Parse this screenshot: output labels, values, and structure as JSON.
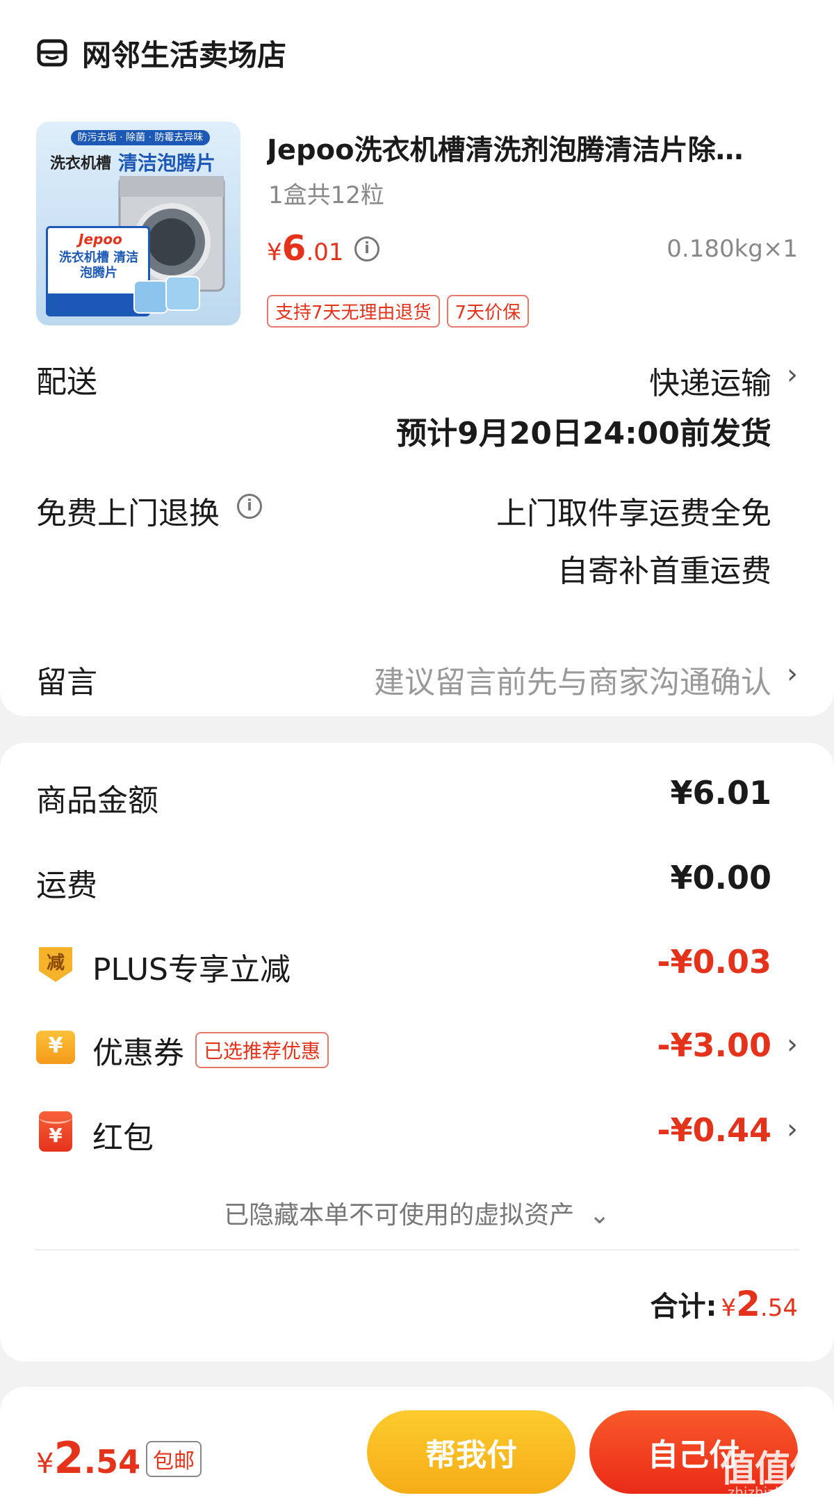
{
  "store": {
    "name": "网邻生活卖场店",
    "icon": "store-icon"
  },
  "product": {
    "title": "Jepoo洗衣机槽清洗剂泡腾清洁片除…",
    "spec": "1盒共12粒",
    "price_symbol": "¥",
    "price_int": "6",
    "price_dec": ".01",
    "weight_qty": "0.180kg×1",
    "tags": [
      "支持7天无理由退货",
      "7天价保"
    ],
    "image": {
      "top_banner": "防污去垢 · 除菌 · 防霉去异味",
      "left_title": "洗衣机槽",
      "right_title": "清洁泡腾片",
      "brand": "Jepoo",
      "box_text": "洗衣机槽 清洁泡腾片"
    }
  },
  "delivery": {
    "label": "配送",
    "method": "快递运输",
    "eta": "预计9月20日24:00前发货"
  },
  "free_return": {
    "label": "免费上门退换",
    "line1": "上门取件享运费全免",
    "line2": "自寄补首重运费"
  },
  "message": {
    "label": "留言",
    "placeholder": "建议留言前先与商家沟通确认"
  },
  "summary": {
    "goods_label": "商品金额",
    "goods_value": "¥6.01",
    "shipping_label": "运费",
    "shipping_value": "¥0.00",
    "plus_label": "PLUS专享立减",
    "plus_icon_text": "减",
    "plus_value": "-¥0.03",
    "coupon_label": "优惠券",
    "coupon_tag": "已选推荐优惠",
    "coupon_icon_text": "¥",
    "coupon_value": "-¥3.00",
    "redpacket_label": "红包",
    "redpacket_icon_text": "¥",
    "redpacket_value": "-¥0.44",
    "hidden_assets": "已隐藏本单不可使用的虚拟资产",
    "total_label": "合计:",
    "total_symbol": "¥",
    "total_int": "2",
    "total_dec": ".54"
  },
  "footer": {
    "price_symbol": "¥",
    "price_int": "2",
    "price_dec": ".54",
    "badge": "包邮",
    "help_pay": "帮我付",
    "self_pay": "自己付",
    "watermark": "值值值",
    "watermark_url": "zhizhizhi.com"
  },
  "colors": {
    "accent": "#e4321b",
    "help_pay_bg": "#fbbf1a",
    "self_pay_bg": "#f2381d"
  }
}
